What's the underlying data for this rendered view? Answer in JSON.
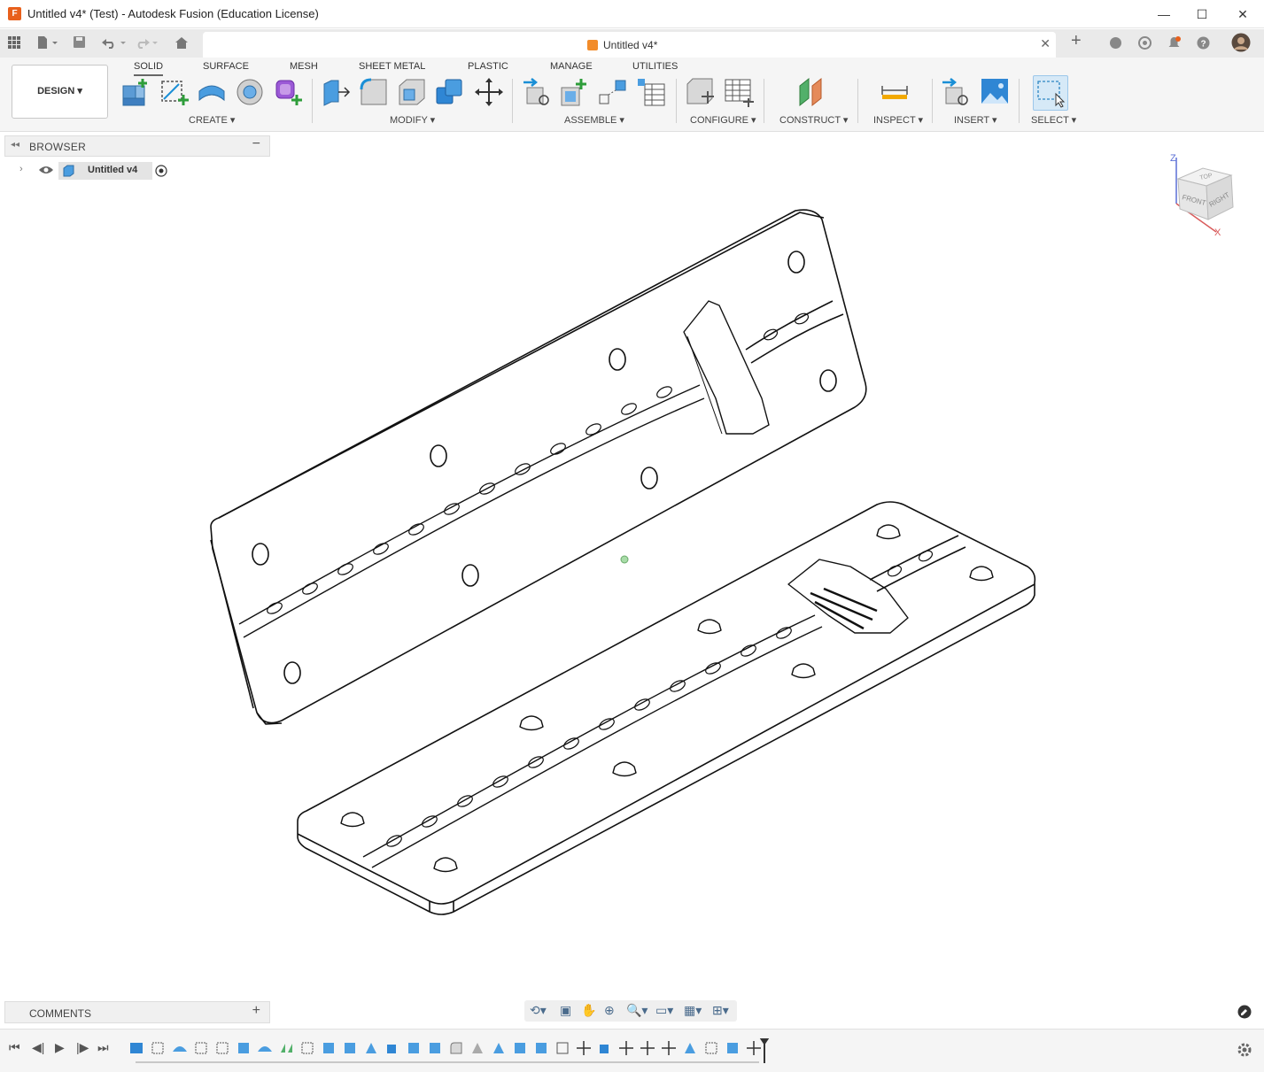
{
  "window": {
    "title": "Untitled v4* (Test) - Autodesk Fusion (Education License)",
    "app_icon_letter": "F",
    "minimize": "—",
    "maximize": "☐",
    "close": "✕"
  },
  "tabs": {
    "doc_tab_label": "Untitled v4*"
  },
  "toolbar": {
    "workspace": "DESIGN",
    "tabs": [
      "SOLID",
      "SURFACE",
      "MESH",
      "SHEET METAL",
      "PLASTIC",
      "MANAGE",
      "UTILITIES"
    ],
    "active_tab": "SOLID",
    "groups": [
      "CREATE",
      "MODIFY",
      "ASSEMBLE",
      "CONFIGURE",
      "CONSTRUCT",
      "INSPECT",
      "INSERT",
      "SELECT"
    ]
  },
  "browser": {
    "title": "BROWSER",
    "root_item": "Untitled v4"
  },
  "comments": {
    "title": "COMMENTS"
  },
  "viewcube": {
    "axis_z": "Z",
    "axis_x": "X",
    "face_top": "TOP",
    "face_front": "FRONT",
    "face_right": "RIGHT"
  },
  "colors": {
    "accent_blue": "#1a8fd6",
    "green_plus": "#2e9d3a",
    "orange_brand": "#e8601c"
  }
}
